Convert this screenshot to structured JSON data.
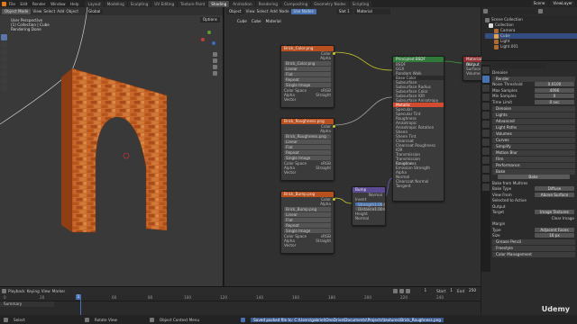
{
  "topbar": {
    "menus": [
      "File",
      "Edit",
      "Render",
      "Window",
      "Help"
    ],
    "workspaces": [
      "Layout",
      "Modeling",
      "Sculpting",
      "UV Editing",
      "Texture Paint",
      "Shading",
      "Animation",
      "Rendering",
      "Compositing",
      "Geometry Nodes",
      "Scripting"
    ],
    "active_workspace": "Shading",
    "scene": "Scene",
    "view_layer": "ViewLayer"
  },
  "viewport": {
    "mode": "Object Mode",
    "menus": [
      "View",
      "Select",
      "Add",
      "Object"
    ],
    "shading": "Global",
    "options": "Options",
    "overlay": [
      "User Perspective",
      "(1) Collection | Cube",
      "Rendering Done"
    ]
  },
  "node_editor": {
    "header": [
      "Object",
      "View",
      "Select",
      "Add",
      "Node"
    ],
    "use_nodes": "Use Nodes",
    "slot": "Slot 1",
    "material": "Material",
    "breadcrumb": [
      "Cube",
      "Cube",
      "Material"
    ],
    "nodes": {
      "tex1": {
        "title": "Brick_Color.png",
        "rows": [
          "Color",
          "Alpha",
          "Brick_Color.png",
          "Linear",
          "Flat",
          "Repeat",
          "Single Image",
          "Color Space",
          "sRGB",
          "Alpha",
          "Straight",
          "Vector"
        ]
      },
      "tex2": {
        "title": "Brick_Roughness.png",
        "rows": [
          "Color",
          "Alpha",
          "Brick_Roughness.png",
          "Linear",
          "Flat",
          "Repeat",
          "Single Image",
          "Color Space",
          "sRGB",
          "Alpha",
          "Straight",
          "Vector"
        ]
      },
      "tex3": {
        "title": "Brick_Bump.png",
        "rows": [
          "Color",
          "Alpha",
          "Brick_Bump.png",
          "Linear",
          "Flat",
          "Repeat",
          "Single Image",
          "Color Space",
          "sRGB",
          "Alpha",
          "Straight",
          "Vector"
        ]
      },
      "bump": {
        "title": "Bump",
        "rows": [
          "Normal",
          "Invert",
          "Strength",
          "1.000",
          "Distance",
          "1.000",
          "Height",
          "Normal"
        ]
      },
      "bsdf": {
        "title": "Principled BSDF",
        "rows": [
          "BSDF",
          "GGX",
          "Random Walk",
          "Base Color",
          "Subsurface",
          "Subsurface Radius",
          "Subsurface Color",
          "Subsurface IOR",
          "Subsurface Anisotropy",
          "Metallic",
          "Specular",
          "Specular Tint",
          "Roughness",
          "Anisotropic",
          "Anisotropic Rotation",
          "Sheen",
          "Sheen Tint",
          "Clearcoat",
          "Clearcoat Roughness",
          "IOR",
          "Transmission",
          "Transmission Roughness",
          "Emission",
          "Emission Strength",
          "Alpha",
          "Normal",
          "Clearcoat Normal",
          "Tangent"
        ]
      },
      "output": {
        "title": "Material Output",
        "rows": [
          "All",
          "Surface",
          "Volume",
          "Displacement"
        ]
      }
    }
  },
  "outliner": {
    "title": "Scene Collection",
    "items": [
      "Collection",
      "Camera",
      "Cube",
      "Light",
      "Light.001"
    ]
  },
  "properties": {
    "rows": [
      {
        "label": "Denoise",
        "value": ""
      },
      {
        "label": "Render",
        "value": ""
      },
      {
        "label": "Noise Threshold",
        "value": "0.0100"
      },
      {
        "label": "Max Samples",
        "value": "4096"
      },
      {
        "label": "Min Samples",
        "value": "0"
      },
      {
        "label": "Time Limit",
        "value": "0 sec"
      }
    ],
    "sections": [
      "Denoise",
      "Lights",
      "Advanced",
      "Light Paths",
      "Volumes",
      "Curves",
      "Simplify",
      "Motion Blur",
      "Film",
      "Performance",
      "Bake"
    ],
    "bake": {
      "button": "Bake",
      "multires": "Bake from Multires",
      "bake_type_label": "Bake Type",
      "bake_type": "Diffuse",
      "view_from_label": "View From",
      "view_from": "Above Surface",
      "selected_to_active": "Selected to Active",
      "output": "Output",
      "target_label": "Target",
      "target": "Image Textures",
      "clear_image": "Clear Image",
      "margin": "Margin",
      "type_label": "Type",
      "type": "Adjacent Faces",
      "size_label": "Size",
      "size": "16 px"
    },
    "footer_sections": [
      "Grease Pencil",
      "Freestyle",
      "Color Management"
    ]
  },
  "timeline": {
    "menus": [
      "Playback",
      "Keying",
      "View",
      "Marker"
    ],
    "current_frame": "1",
    "start_label": "Start",
    "start": "1",
    "end_label": "End",
    "end": "250",
    "ticks": [
      "0",
      "20",
      "40",
      "60",
      "80",
      "100",
      "120",
      "140",
      "160",
      "180",
      "200",
      "220",
      "240"
    ],
    "summary": "Summary"
  },
  "status": {
    "select": "Select",
    "rotate": "Rotate View",
    "context": "Object Context Menu",
    "message": "Saved packed file to: C:\\Users\\gabriel\\OneDrive\\Documents\\Projects\\textures\\Brick_Roughness.png",
    "watermark": "Udemy"
  },
  "colors": {
    "accent": "#4772b3",
    "shader_header": "#2f7a39",
    "texture_header": "#b84f1f"
  }
}
